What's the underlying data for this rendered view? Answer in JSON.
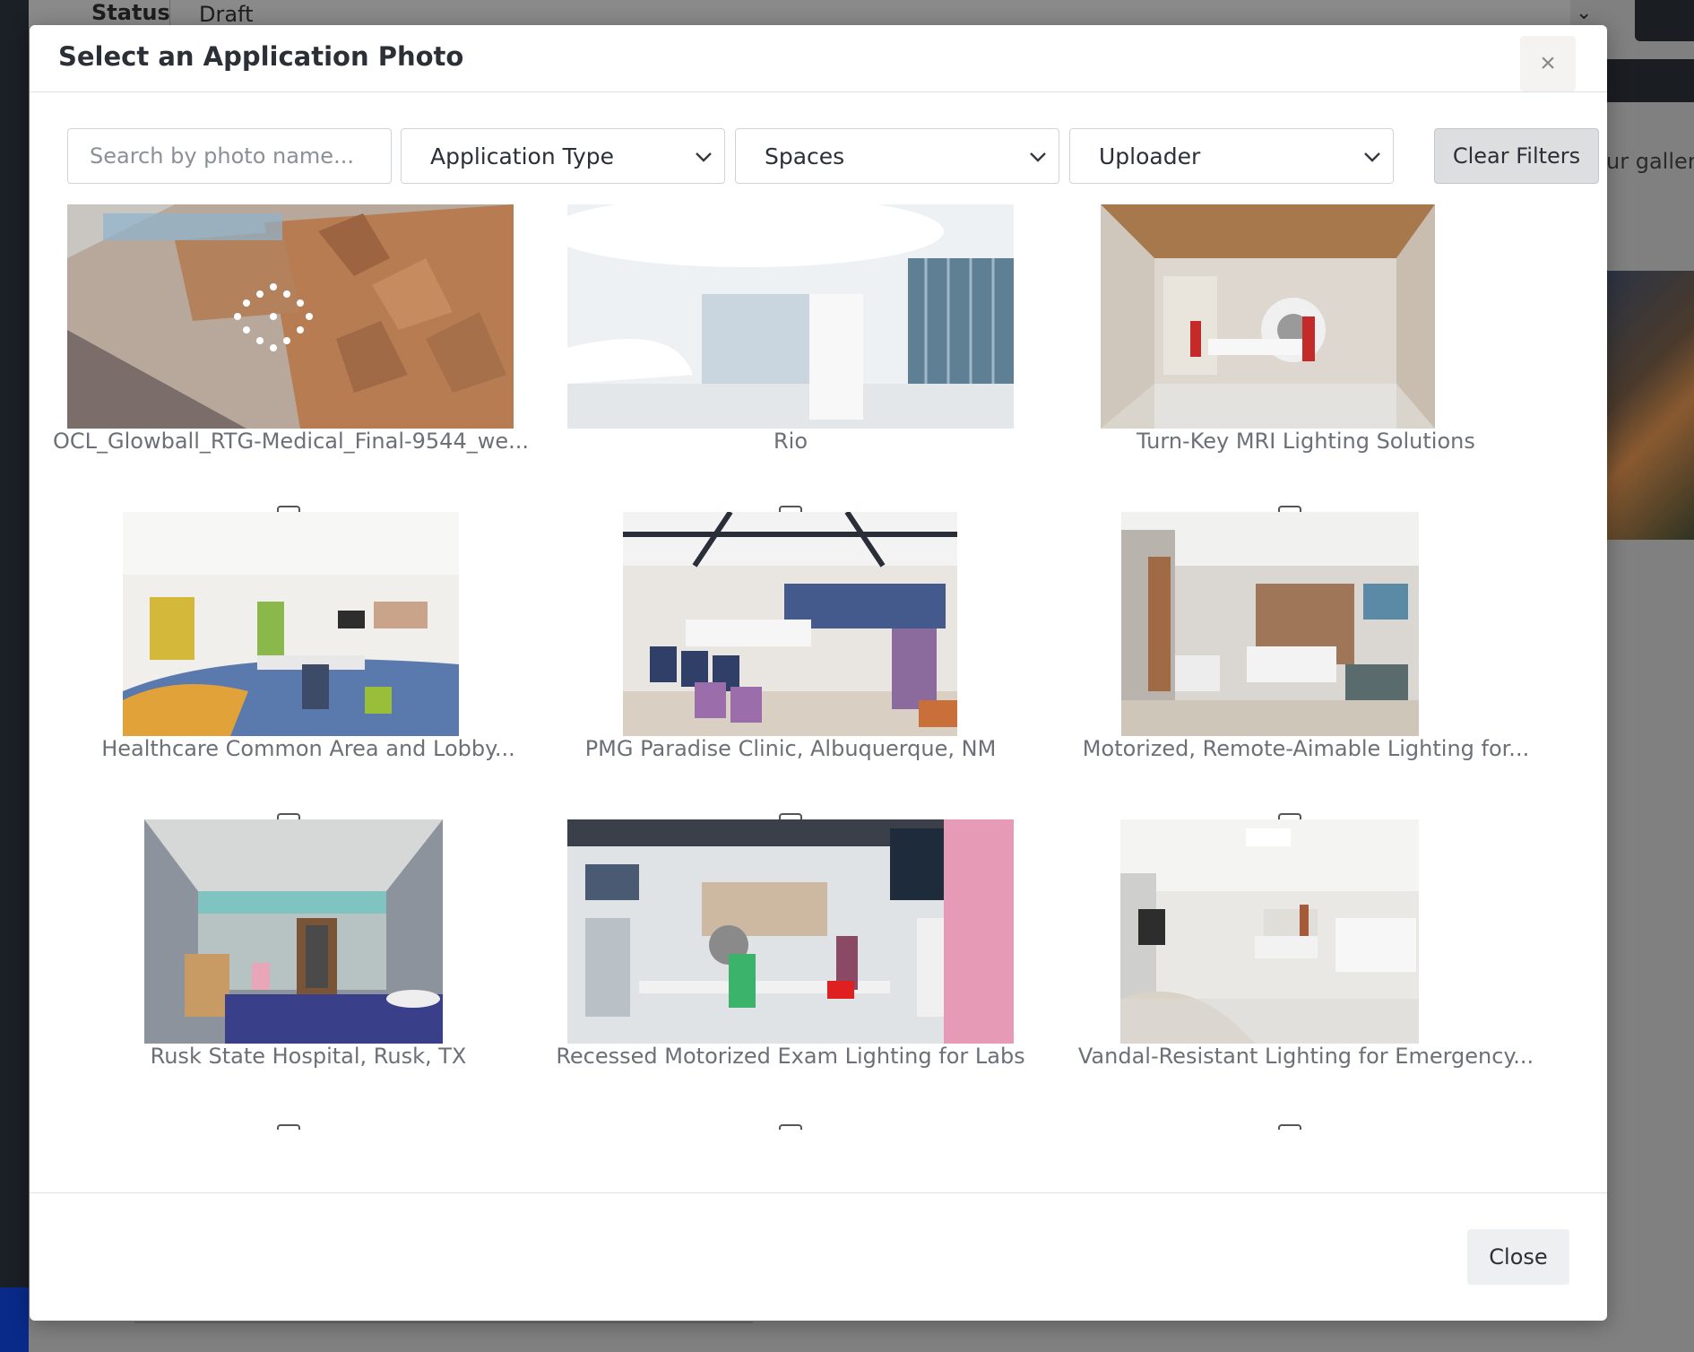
{
  "background": {
    "status_label": "Status",
    "status_value": "Draft",
    "right_snippet": "ur galler"
  },
  "modal": {
    "title": "Select an Application Photo",
    "close_icon": "close-icon"
  },
  "filters": {
    "search_placeholder": "Search by photo name...",
    "application_type": "Application Type",
    "spaces": "Spaces",
    "uploader": "Uploader",
    "clear_label": "Clear Filters"
  },
  "photos": [
    {
      "caption": "OCL_Glowball_RTG-Medical_Final-9544_we..."
    },
    {
      "caption": "Rio"
    },
    {
      "caption": "Turn-Key MRI Lighting Solutions"
    },
    {
      "caption": "Healthcare Common Area and Lobby..."
    },
    {
      "caption": "PMG Paradise Clinic, Albuquerque, NM"
    },
    {
      "caption": "Motorized, Remote-Aimable Lighting for..."
    },
    {
      "caption": "Rusk State Hospital, Rusk, TX"
    },
    {
      "caption": "Recessed Motorized Exam Lighting for Labs"
    },
    {
      "caption": "Vandal-Resistant Lighting for Emergency..."
    }
  ],
  "footer": {
    "close_label": "Close"
  }
}
